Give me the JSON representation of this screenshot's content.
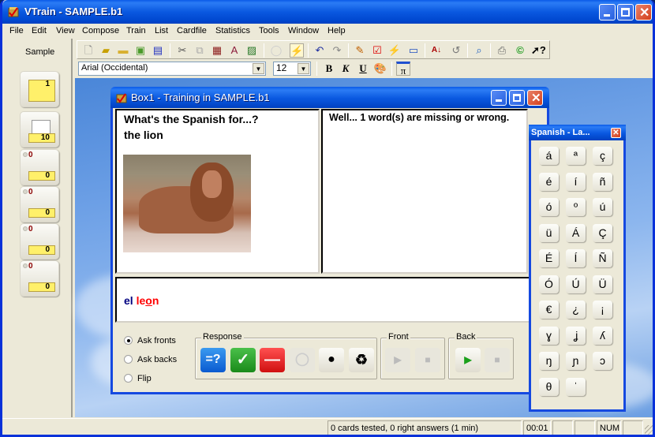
{
  "app": {
    "title": "VTrain - SAMPLE.b1",
    "menu": [
      "File",
      "Edit",
      "View",
      "Compose",
      "Train",
      "List",
      "Cardfile",
      "Statistics",
      "Tools",
      "Window",
      "Help"
    ]
  },
  "left_pane": {
    "label": "Sample",
    "boxes": [
      {
        "number": "1",
        "counter": ""
      },
      {
        "number": "10",
        "counter": ""
      },
      {
        "number": "0",
        "counter": "0"
      },
      {
        "number": "0",
        "counter": "0"
      },
      {
        "number": "0",
        "counter": "0"
      },
      {
        "number": "0",
        "counter": "0"
      }
    ]
  },
  "toolbar": {
    "icons": [
      "new-file-icon",
      "open-folder-icon",
      "open-box-icon",
      "import-icon",
      "save-all-icon",
      "cut-icon",
      "copy-icon",
      "paste-icon",
      "format-icon",
      "picture-icon",
      "hint-bulb-icon",
      "train-icon",
      "undo-icon",
      "redo-icon",
      "edit-card-icon",
      "check-box-icon",
      "flash-box-icon",
      "window-icon",
      "sort-az-icon",
      "refresh-icon",
      "preview-icon",
      "print-icon",
      "copyright-icon",
      "context-help-icon"
    ],
    "font_value": "Arial (Occidental)",
    "size_value": "12",
    "bold": "B",
    "italic": "K",
    "underline": "U",
    "pi": "π"
  },
  "training_window": {
    "title": "Box1 - Training in SAMPLE.b1",
    "question_line1": "What's the Spanish for...?",
    "question_line2": "the lion",
    "feedback": "Well... 1 word(s) are missing or wrong.",
    "answer_word1": "el",
    "answer_word2_a": "le",
    "answer_word2_b": "o",
    "answer_word2_c": "n",
    "answer_colors": {
      "correct": "#000080",
      "wrong": "#ff0000"
    },
    "modes": [
      {
        "label": "Ask fronts",
        "selected": true
      },
      {
        "label": "Ask backs",
        "selected": false
      },
      {
        "label": "Flip",
        "selected": false
      }
    ],
    "response_group": "Response",
    "response_buttons": [
      "=?",
      "✓",
      "—",
      "",
      "",
      ""
    ],
    "front_group": "Front",
    "back_group": "Back"
  },
  "keyboard": {
    "title": "Spanish - La...",
    "keys": [
      "á",
      "ª",
      "ç",
      "é",
      "í",
      "ñ",
      "ó",
      "º",
      "ú",
      "ü",
      "Á",
      "Ç",
      "É",
      "Í",
      "Ñ",
      "Ó",
      "Ú",
      "Ü",
      "€",
      "¿",
      "¡",
      "ɣ",
      "ʝ",
      "ʎ",
      "ŋ",
      "ɲ",
      "ɔ",
      "θ",
      "ˈ"
    ]
  },
  "statusbar": {
    "message": "0 cards tested, 0 right answers (1 min)",
    "time": "00:01",
    "num": "NUM"
  }
}
